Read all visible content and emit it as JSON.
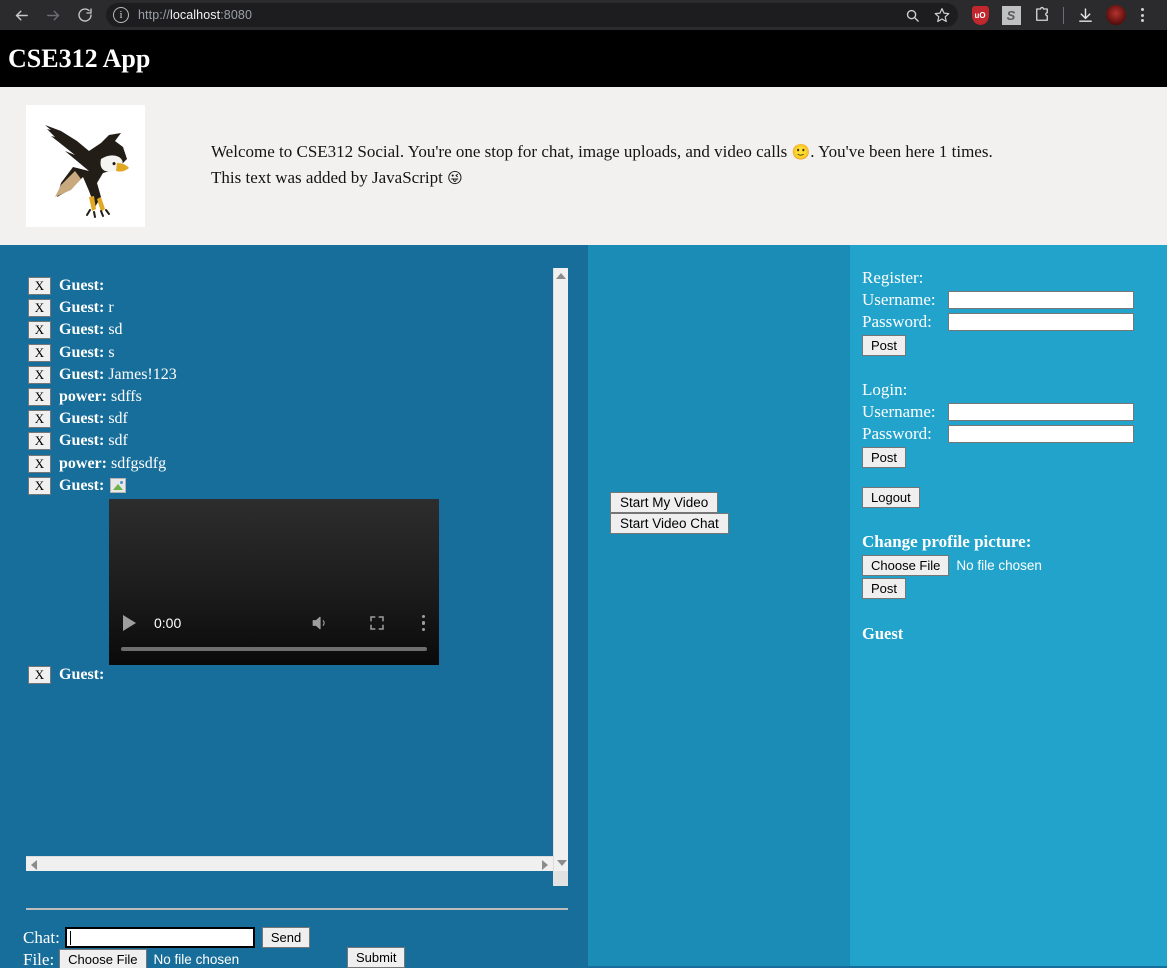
{
  "browser": {
    "back_icon": "back-arrow-icon",
    "forward_icon": "forward-arrow-icon",
    "reload_icon": "reload-icon",
    "site_info_icon": "info-circle-icon",
    "url_prefix": "http://",
    "url_host": "localhost",
    "url_port": ":8080",
    "url_full": "http://localhost:8080",
    "search_icon": "search-icon",
    "bookmark_icon": "star-icon",
    "extensions": [
      {
        "name": "ublock-origin-icon",
        "label": "uO"
      },
      {
        "name": "gray-extension-icon",
        "label": "S"
      },
      {
        "name": "puzzle-piece-icon",
        "label": ""
      },
      {
        "name": "download-icon",
        "label": ""
      },
      {
        "name": "profile-avatar",
        "label": ""
      },
      {
        "name": "chrome-menu-icon",
        "label": ""
      }
    ]
  },
  "app": {
    "title": "CSE312 App",
    "banner": {
      "image_alt": "bald-eagle-image",
      "line1": "Welcome to CSE312 Social. You're one stop for chat, image uploads, and video calls",
      "emoji1": "🙂",
      "line1_tail": ". You've been here 1 times.",
      "line2": "This text was added by JavaScript",
      "emoji2": "😜",
      "visit_count": "1"
    }
  },
  "chat": {
    "messages": [
      {
        "delete_label": "X",
        "user": "Guest:",
        "text": ""
      },
      {
        "delete_label": "X",
        "user": "Guest:",
        "text": "r"
      },
      {
        "delete_label": "X",
        "user": "Guest:",
        "text": "sd"
      },
      {
        "delete_label": "X",
        "user": "Guest:",
        "text": "s"
      },
      {
        "delete_label": "X",
        "user": "Guest:",
        "text": "James!123"
      },
      {
        "delete_label": "X",
        "user": "power:",
        "text": "sdffs"
      },
      {
        "delete_label": "X",
        "user": "Guest:",
        "text": "sdf"
      },
      {
        "delete_label": "X",
        "user": "Guest:",
        "text": "sdf"
      },
      {
        "delete_label": "X",
        "user": "power:",
        "text": "sdfgsdfg"
      },
      {
        "delete_label": "X",
        "user": "Guest:",
        "text": "",
        "attachment": "broken-image-icon"
      }
    ],
    "video_message": {
      "delete_label": "X",
      "user": "Guest:",
      "player": {
        "current_time": "0:00",
        "play_icon": "play-icon",
        "volume_icon": "volume-icon",
        "fullscreen_icon": "fullscreen-icon",
        "more_icon": "video-more-options-icon"
      }
    },
    "form": {
      "chat_label": "Chat:",
      "chat_value": "",
      "chat_placeholder": "",
      "send_label": "Send",
      "file_label": "File:",
      "choose_file_label": "Choose File",
      "no_file_label": "No file chosen",
      "submit_label": "Submit"
    }
  },
  "video_panel": {
    "start_my_video_label": "Start My Video",
    "start_video_chat_label": "Start Video Chat"
  },
  "account_panel": {
    "register": {
      "heading": "Register:",
      "username_label": "Username:",
      "username_value": "",
      "password_label": "Password:",
      "password_value": "",
      "post_label": "Post"
    },
    "login": {
      "heading": "Login:",
      "username_label": "Username:",
      "username_value": "",
      "password_label": "Password:",
      "password_value": "",
      "post_label": "Post"
    },
    "logout_label": "Logout",
    "profile": {
      "heading": "Change profile picture:",
      "choose_file_label": "Choose File",
      "no_file_label": "No file chosen",
      "post_label": "Post"
    },
    "current_user": "Guest"
  },
  "colors": {
    "chrome_bar": "#2b2b2d",
    "app_header": "#000000",
    "banner_bg": "#f3f1f0",
    "panel_left": "#186e9a",
    "panel_mid": "#1a8cb5",
    "panel_right": "#21a3cb",
    "button_face": "#efefef",
    "ublock_red": "#c1272d"
  }
}
